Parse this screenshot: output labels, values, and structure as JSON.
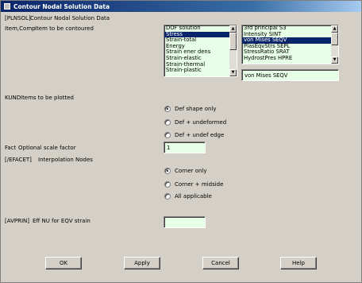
{
  "window": {
    "title": "Contour Nodal Solution Data"
  },
  "header": {
    "command": "[PLNSOL]",
    "description": "Contour Nodal Solution Data"
  },
  "item_comp": {
    "label": "Item,Comp",
    "description": "Item to be contoured",
    "items": [
      "DOF solution",
      "Stress",
      "Strain-total",
      "Energy",
      "Strain ener dens",
      "Strain-elastic",
      "Strain-thermal",
      "Strain-plastic"
    ],
    "selected_item": "Stress",
    "components": [
      "3rd principal S3",
      "Intensity  SINT",
      "von Mises  SEQV",
      "PlasEqvStrs SEPL",
      "StressRatio SRAT",
      "HydrostPres HPRE"
    ],
    "selected_component": "von Mises  SEQV",
    "component_value": "von Mises  SEQV"
  },
  "kund": {
    "label": "KUND",
    "description": "Items to be plotted",
    "options": [
      "Def shape only",
      "Def + undeformed",
      "Def + undef edge"
    ],
    "selected": "Def shape only"
  },
  "fact": {
    "label": "Fact",
    "description": "Optional scale factor",
    "value": "1"
  },
  "efacet": {
    "label": "[/EFACET]",
    "description": "Interpolation Nodes",
    "options": [
      "Corner only",
      "Corner + midside",
      "All applicable"
    ],
    "selected": "Corner only"
  },
  "avprin": {
    "label": "[AVPRIN]",
    "description": "Eff NU for EQV strain",
    "value": ""
  },
  "buttons": {
    "ok": "OK",
    "apply": "Apply",
    "cancel": "Cancel",
    "help": "Help"
  }
}
